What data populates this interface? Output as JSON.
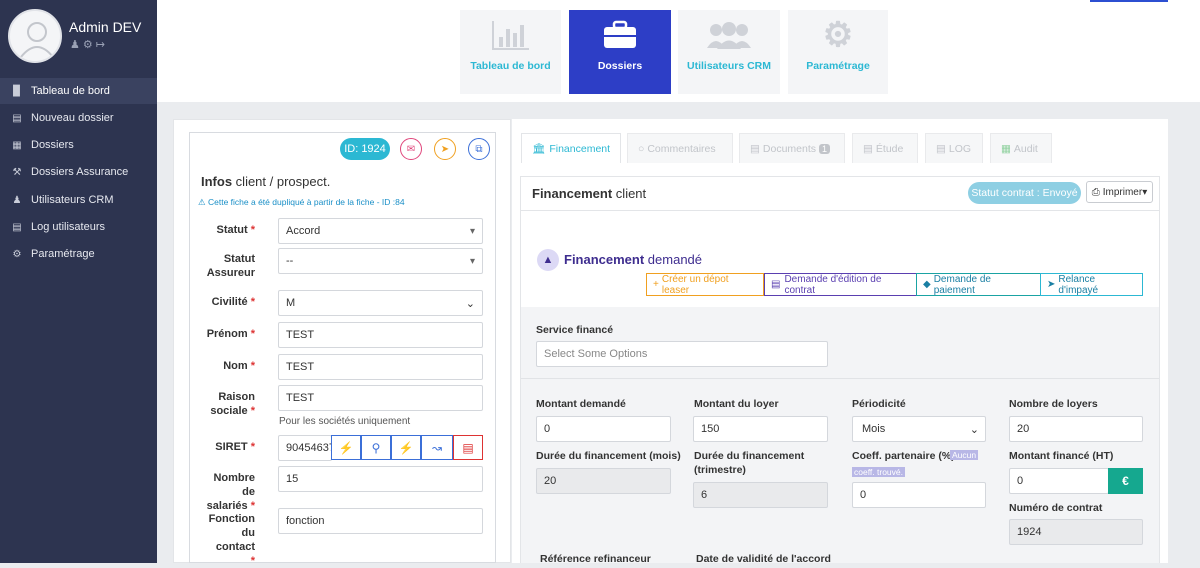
{
  "user": {
    "name": "Admin DEV"
  },
  "sidebar": {
    "items": [
      {
        "label": "Tableau de bord",
        "icon": "bar-chart-icon",
        "active": true
      },
      {
        "label": "Nouveau dossier",
        "icon": "folder-plus-icon"
      },
      {
        "label": "Dossiers",
        "icon": "briefcase-icon"
      },
      {
        "label": "Dossiers Assurance",
        "icon": "wrench-icon"
      },
      {
        "label": "Utilisateurs CRM",
        "icon": "users-icon"
      },
      {
        "label": "Log utilisateurs",
        "icon": "database-icon"
      },
      {
        "label": "Paramétrage",
        "icon": "gear-icon"
      }
    ]
  },
  "topnav": {
    "tiles": [
      {
        "label": "Tableau de bord",
        "icon": "bar-chart-icon"
      },
      {
        "label": "Dossiers",
        "icon": "briefcase-icon",
        "active": true
      },
      {
        "label": "Utilisateurs CRM",
        "icon": "users-icon"
      },
      {
        "label": "Paramétrage",
        "icon": "gear-icon"
      }
    ]
  },
  "client": {
    "id_badge": "ID: 1924",
    "title_bold": "Infos",
    "title_rest": " client / prospect.",
    "notice": "Cette fiche a été dupliqué à partir de la fiche - ID :84",
    "fields": {
      "statut": {
        "label": "Statut",
        "value": "Accord"
      },
      "statut_assureur": {
        "label1": "Statut",
        "label2": "Assureur",
        "value": "--"
      },
      "civilite": {
        "label": "Civilité",
        "value": "M"
      },
      "prenom": {
        "label": "Prénom",
        "value": "TEST"
      },
      "nom": {
        "label": "Nom",
        "value": "TEST"
      },
      "raison_sociale": {
        "label1": "Raison",
        "label2": "sociale",
        "value": "TEST",
        "help": "Pour les sociétés uniquement"
      },
      "siret": {
        "label": "SIRET",
        "value": "904546379"
      },
      "nb_salaries": {
        "label1": "Nombre de",
        "label2": "salariés",
        "value": "15"
      },
      "fonction": {
        "label1": "Fonction",
        "label2": "du contact",
        "value": "fonction"
      }
    }
  },
  "tabs": [
    {
      "label": "Financement",
      "icon": "bank-icon",
      "active": true
    },
    {
      "label": "Commentaires",
      "icon": "comment-icon"
    },
    {
      "label": "Documents",
      "icon": "file-pdf-icon",
      "badge": "1"
    },
    {
      "label": "Étude",
      "icon": "file-icon"
    },
    {
      "label": "LOG",
      "icon": "file-log-icon"
    },
    {
      "label": "Audit",
      "icon": "table-icon"
    }
  ],
  "financement": {
    "header_bold": "Financement",
    "header_rest": " client",
    "statut_contrat": "Statut contrat : Envoyé",
    "print_label": "Imprimer",
    "section_bold": "Financement",
    "section_rest": " demandé",
    "actions": [
      {
        "label": "Créer un dépot leaser",
        "icon": "plus-icon"
      },
      {
        "label": "Demande d'édition de contrat",
        "icon": "file-icon"
      },
      {
        "label": "Demande de paiement",
        "icon": "tag-icon"
      },
      {
        "label": "Relance d'impayé",
        "icon": "send-icon"
      }
    ],
    "service_label": "Service financé",
    "service_placeholder": "Select Some Options",
    "montant_demande": {
      "label": "Montant demandé",
      "value": "0"
    },
    "montant_loyer": {
      "label": "Montant du loyer",
      "value": "150"
    },
    "periodicite": {
      "label": "Périodicité",
      "value": "Mois"
    },
    "nombre_loyers": {
      "label": "Nombre de loyers",
      "value": "20"
    },
    "duree_mois": {
      "label": "Durée du financement (mois)",
      "value": "20"
    },
    "duree_trimestre": {
      "label1": "Durée du financement",
      "label2": "(trimestre)",
      "value": "6"
    },
    "coeff": {
      "label": "Coeff. partenaire (%)",
      "note1": "Aucun",
      "note2": "coeff. trouvé.",
      "value": "0"
    },
    "montant_finance": {
      "label": "Montant financé (HT)",
      "value": "0",
      "currency": "€"
    },
    "numero_contrat": {
      "label": "Numéro de contrat",
      "value": "1924"
    },
    "reference_label": "Référence refinanceur",
    "date_validite_label": "Date de validité de l'accord"
  }
}
